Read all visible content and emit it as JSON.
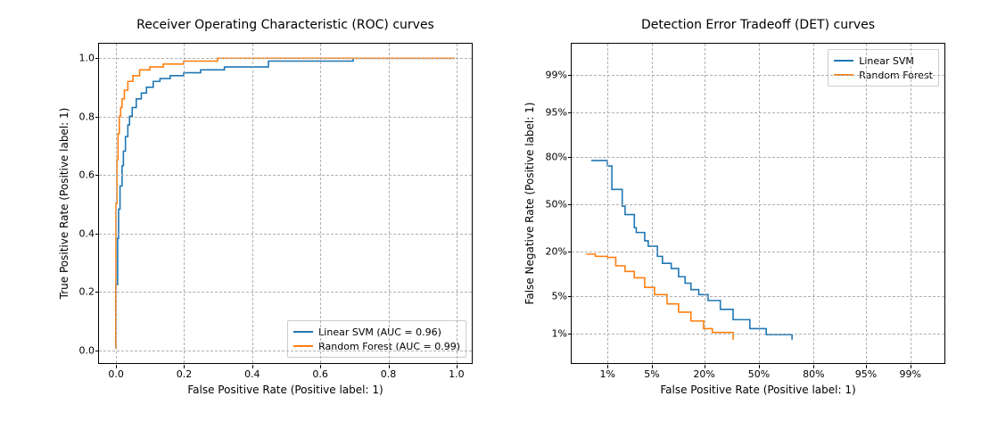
{
  "colors": {
    "series0": "#1f77b4",
    "series1": "#ff7f0e"
  },
  "chart_data": [
    {
      "type": "line",
      "title": "Receiver Operating Characteristic (ROC) curves",
      "xlabel": "False Positive Rate (Positive label: 1)",
      "ylabel": "True Positive Rate (Positive label: 1)",
      "xlim": [
        -0.05,
        1.05
      ],
      "ylim": [
        -0.05,
        1.05
      ],
      "x_ticks": [
        0.0,
        0.2,
        0.4,
        0.6,
        0.8,
        1.0
      ],
      "y_ticks": [
        0.0,
        0.2,
        0.4,
        0.6,
        0.8,
        1.0
      ],
      "x_tick_labels": [
        "0.0",
        "0.2",
        "0.4",
        "0.6",
        "0.8",
        "1.0"
      ],
      "y_tick_labels": [
        "0.0",
        "0.2",
        "0.4",
        "0.6",
        "0.8",
        "1.0"
      ],
      "legend_position": "lower right",
      "grid": true,
      "series": [
        {
          "name": "Linear SVM (AUC = 0.96)",
          "color_key": "series0",
          "x": [
            0.0,
            0.0,
            0.005,
            0.005,
            0.008,
            0.008,
            0.012,
            0.012,
            0.018,
            0.018,
            0.022,
            0.022,
            0.028,
            0.028,
            0.035,
            0.035,
            0.04,
            0.04,
            0.048,
            0.048,
            0.06,
            0.06,
            0.075,
            0.075,
            0.09,
            0.09,
            0.11,
            0.11,
            0.13,
            0.13,
            0.16,
            0.16,
            0.2,
            0.2,
            0.25,
            0.25,
            0.32,
            0.32,
            0.45,
            0.45,
            0.7,
            0.7,
            1.0
          ],
          "y": [
            0.0,
            0.22,
            0.22,
            0.38,
            0.38,
            0.48,
            0.48,
            0.56,
            0.56,
            0.63,
            0.63,
            0.68,
            0.68,
            0.73,
            0.73,
            0.77,
            0.77,
            0.8,
            0.8,
            0.83,
            0.83,
            0.86,
            0.86,
            0.88,
            0.88,
            0.9,
            0.9,
            0.92,
            0.92,
            0.93,
            0.93,
            0.94,
            0.94,
            0.95,
            0.95,
            0.96,
            0.96,
            0.97,
            0.97,
            0.99,
            0.99,
            1.0,
            1.0
          ]
        },
        {
          "name": "Random Forest (AUC = 0.99)",
          "color_key": "series1",
          "x": [
            0.0,
            0.0,
            0.003,
            0.003,
            0.006,
            0.006,
            0.01,
            0.01,
            0.014,
            0.014,
            0.018,
            0.018,
            0.025,
            0.025,
            0.035,
            0.035,
            0.05,
            0.05,
            0.07,
            0.07,
            0.1,
            0.1,
            0.14,
            0.14,
            0.2,
            0.2,
            0.3,
            0.3,
            0.5,
            0.5,
            1.0
          ],
          "y": [
            0.0,
            0.5,
            0.5,
            0.65,
            0.65,
            0.74,
            0.74,
            0.8,
            0.8,
            0.83,
            0.83,
            0.86,
            0.86,
            0.89,
            0.89,
            0.92,
            0.92,
            0.94,
            0.94,
            0.96,
            0.96,
            0.97,
            0.97,
            0.98,
            0.98,
            0.99,
            0.99,
            1.0,
            1.0,
            1.0,
            1.0
          ]
        }
      ]
    },
    {
      "type": "line",
      "title": "Detection Error Tradeoff (DET) curves",
      "xlabel": "False Positive Rate (Positive label: 1)",
      "ylabel": "False Negative Rate (Positive label: 1)",
      "axis_scale": "normal-deviate",
      "xlim_prob": [
        0.002,
        0.998
      ],
      "ylim_prob": [
        0.002,
        0.998
      ],
      "x_ticks_prob": [
        0.01,
        0.05,
        0.2,
        0.5,
        0.8,
        0.95,
        0.99
      ],
      "y_ticks_prob": [
        0.01,
        0.05,
        0.2,
        0.5,
        0.8,
        0.95,
        0.99
      ],
      "x_tick_labels": [
        "1%",
        "5%",
        "20%",
        "50%",
        "80%",
        "95%",
        "99%"
      ],
      "y_tick_labels": [
        "1%",
        "5%",
        "20%",
        "50%",
        "80%",
        "95%",
        "99%"
      ],
      "legend_position": "upper right",
      "grid": true,
      "series": [
        {
          "name": "Linear SVM",
          "color_key": "series0",
          "x_prob": [
            0.005,
            0.01,
            0.012,
            0.018,
            0.02,
            0.028,
            0.03,
            0.04,
            0.045,
            0.06,
            0.07,
            0.09,
            0.11,
            0.13,
            0.15,
            0.18,
            0.22,
            0.28,
            0.35,
            0.45,
            0.55,
            0.7
          ],
          "y_prob": [
            0.78,
            0.75,
            0.6,
            0.48,
            0.42,
            0.33,
            0.3,
            0.25,
            0.22,
            0.17,
            0.14,
            0.12,
            0.093,
            0.075,
            0.06,
            0.05,
            0.04,
            0.028,
            0.018,
            0.012,
            0.009,
            0.007
          ],
          "step": true
        },
        {
          "name": "Random Forest",
          "color_key": "series1",
          "x_prob": [
            0.004,
            0.006,
            0.01,
            0.014,
            0.02,
            0.028,
            0.04,
            0.055,
            0.08,
            0.11,
            0.15,
            0.2,
            0.24,
            0.3,
            0.35
          ],
          "y_prob": [
            0.18,
            0.17,
            0.165,
            0.13,
            0.11,
            0.09,
            0.065,
            0.05,
            0.035,
            0.025,
            0.017,
            0.012,
            0.01,
            0.01,
            0.007
          ],
          "step": true
        }
      ]
    }
  ]
}
